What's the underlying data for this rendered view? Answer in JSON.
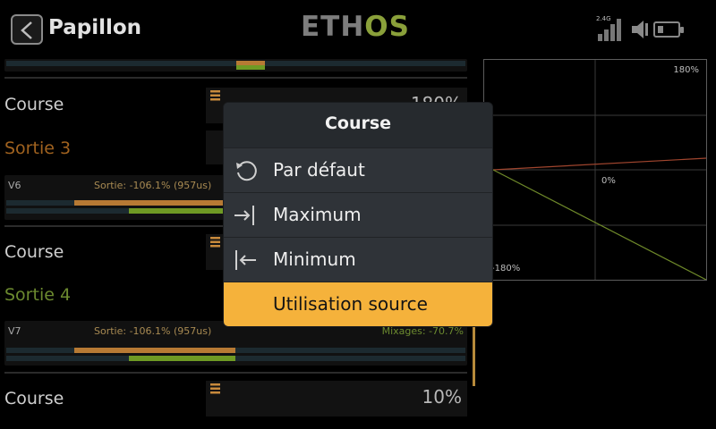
{
  "header": {
    "title": "Papillon",
    "logo_left": "ETH",
    "logo_right": "OS",
    "signal_label": "2.4G",
    "signal_bars": 4,
    "battery_level": 0.2
  },
  "list": {
    "rows": [
      {
        "label": "Course",
        "value": "180%"
      },
      {
        "section": "Sortie 3",
        "section_color": "#a0621f"
      },
      {
        "channel": "V6",
        "output": "Sortie: -106.1% (957us)",
        "mix": ""
      },
      {
        "label": "Course",
        "value": ""
      },
      {
        "section": "Sortie 4",
        "section_color": "#6c8a2f"
      },
      {
        "channel": "V7",
        "output": "Sortie: -106.1% (957us)",
        "mix": "Mixages: -70.7%"
      },
      {
        "label": "Course",
        "value": "10%"
      }
    ]
  },
  "graph": {
    "top_label": "180%",
    "mid_label": "0%",
    "bottom_label": "-180%"
  },
  "popup": {
    "title": "Course",
    "options": [
      {
        "label": "Par défaut",
        "icon": "reset-icon"
      },
      {
        "label": "Maximum",
        "icon": "arrow-to-max-icon"
      },
      {
        "label": "Minimum",
        "icon": "arrow-to-min-icon"
      },
      {
        "label": "Utilisation source",
        "icon": "",
        "selected": true
      }
    ]
  },
  "colors": {
    "accent": "#f5b23b",
    "orange_bar": "#b77a34",
    "green_bar": "#6f9a24",
    "logo_green": "#8aa03a"
  }
}
